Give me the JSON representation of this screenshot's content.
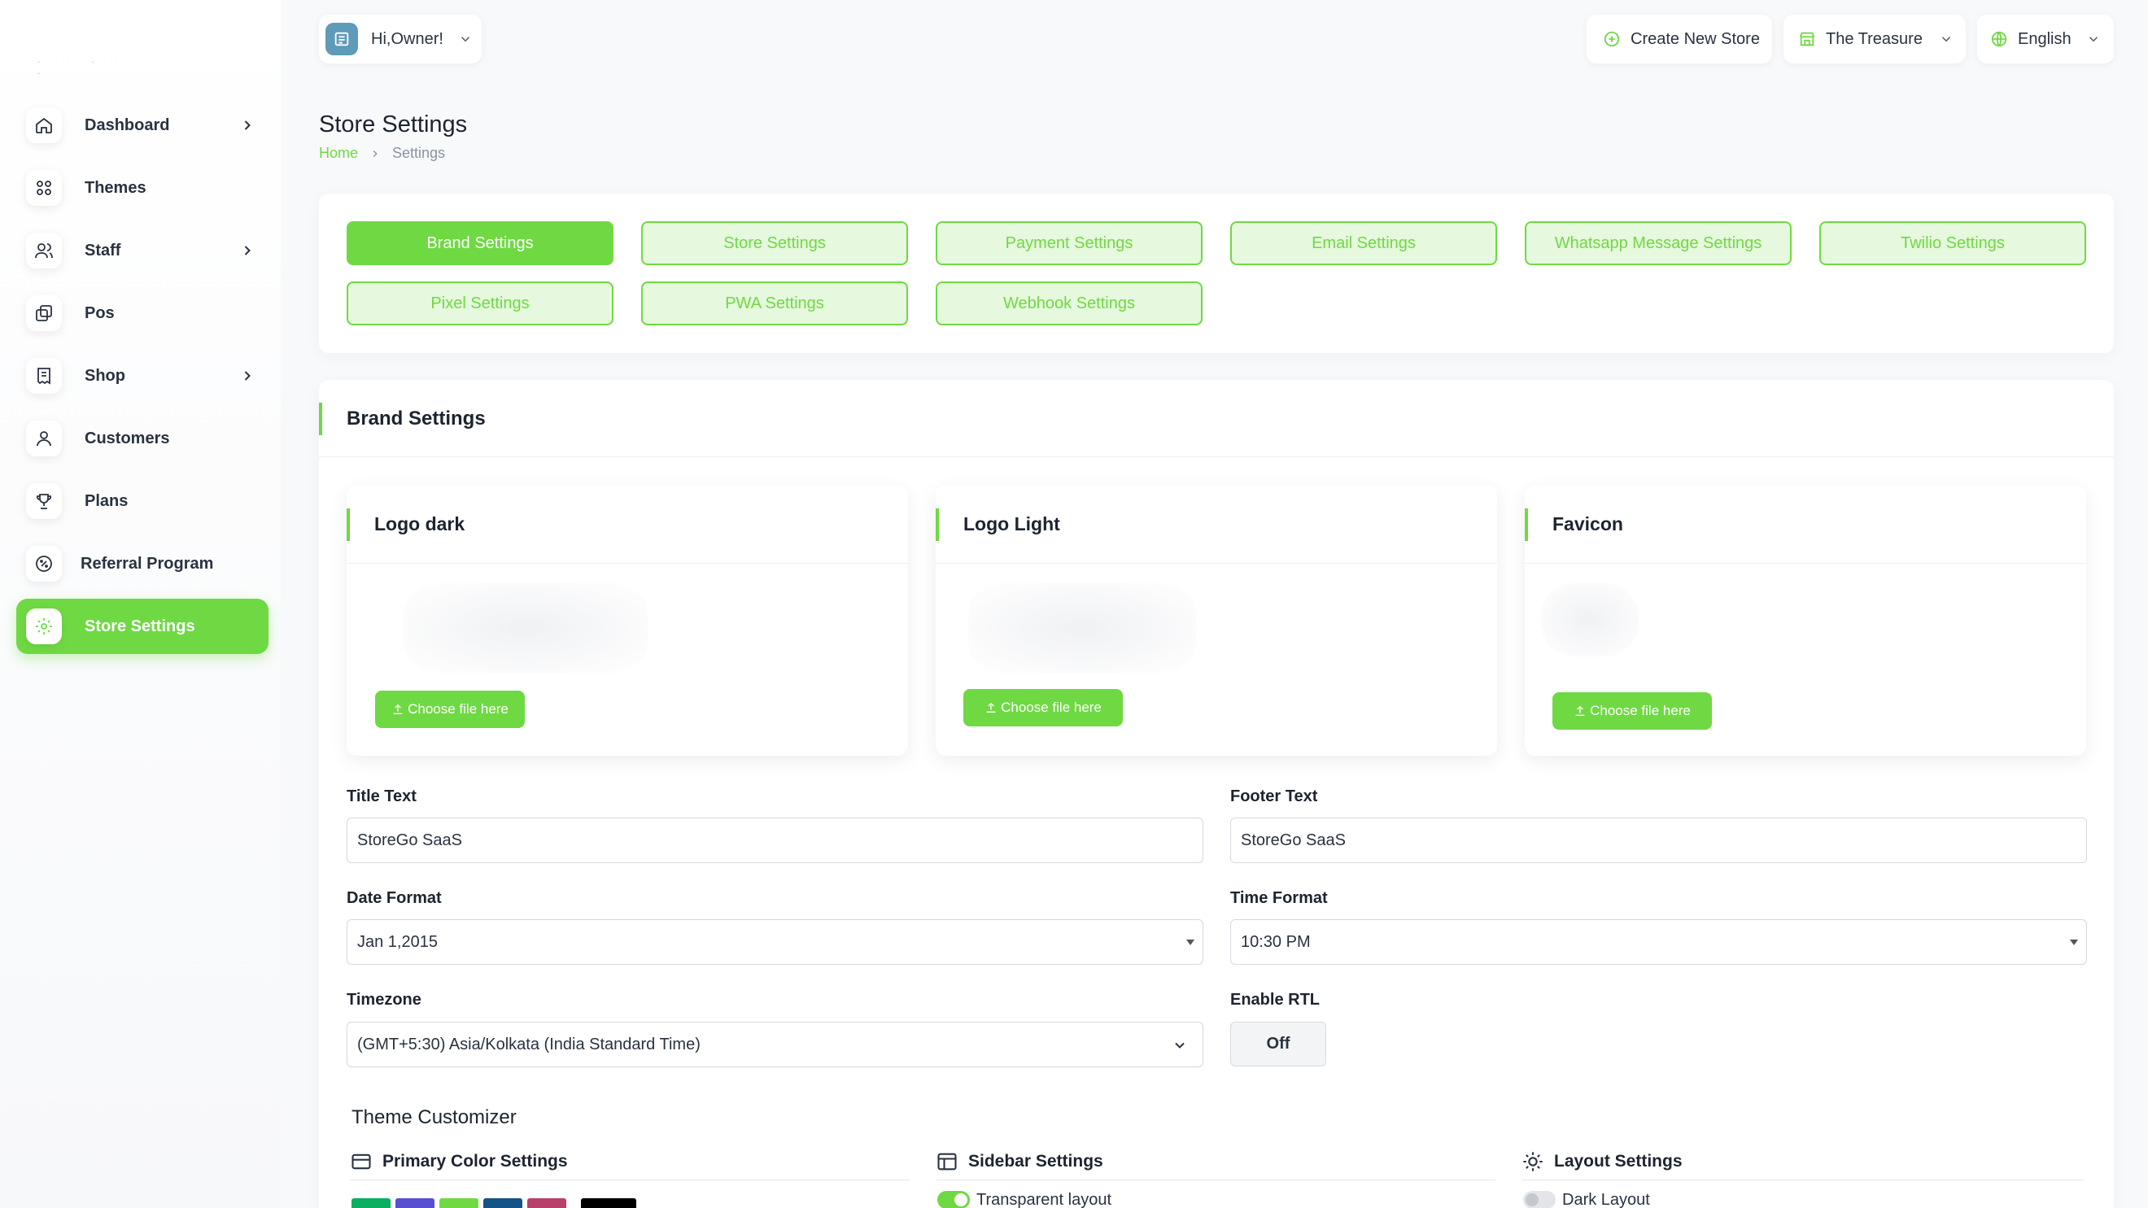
{
  "header": {
    "greeting": "Hi,Owner!",
    "create_store": "Create New Store",
    "store_name": "The Treasure",
    "language": "English"
  },
  "sidebar": {
    "items": [
      {
        "label": "Dashboard",
        "icon": "home-icon",
        "has_children": true
      },
      {
        "label": "Themes",
        "icon": "grid-icon",
        "has_children": false
      },
      {
        "label": "Staff",
        "icon": "users-icon",
        "has_children": true
      },
      {
        "label": "Pos",
        "icon": "layers-icon",
        "has_children": false
      },
      {
        "label": "Shop",
        "icon": "receipt-icon",
        "has_children": true
      },
      {
        "label": "Customers",
        "icon": "user-icon",
        "has_children": false
      },
      {
        "label": "Plans",
        "icon": "trophy-icon",
        "has_children": false
      },
      {
        "label": "Referral Program",
        "icon": "discount-icon",
        "has_children": false
      },
      {
        "label": "Store Settings",
        "icon": "settings-icon",
        "has_children": false,
        "active": true
      }
    ]
  },
  "page": {
    "title": "Store Settings",
    "breadcrumb": [
      "Home",
      "Settings"
    ]
  },
  "settings_tabs": [
    {
      "label": "Brand Settings",
      "active": true
    },
    {
      "label": "Store Settings"
    },
    {
      "label": "Payment Settings"
    },
    {
      "label": "Email Settings"
    },
    {
      "label": "Whatsapp Message Settings"
    },
    {
      "label": "Twilio Settings"
    },
    {
      "label": "Pixel Settings"
    },
    {
      "label": "PWA Settings"
    },
    {
      "label": "Webhook Settings"
    }
  ],
  "brand": {
    "section_title": "Brand Settings",
    "uploads": [
      {
        "title": "Logo dark",
        "button": "Choose file here"
      },
      {
        "title": "Logo Light",
        "button": "Choose file here"
      },
      {
        "title": "Favicon",
        "button": "Choose file here"
      }
    ],
    "fields": {
      "title_text": {
        "label": "Title Text",
        "value": "StoreGo SaaS"
      },
      "footer_text": {
        "label": "Footer Text",
        "value": "StoreGo SaaS"
      },
      "date_format": {
        "label": "Date Format",
        "value": "Jan 1,2015"
      },
      "time_format": {
        "label": "Time Format",
        "value": "10:30 PM"
      },
      "timezone": {
        "label": "Timezone",
        "value": "(GMT+5:30) Asia/Kolkata (India Standard Time)"
      },
      "enable_rtl": {
        "label": "Enable RTL",
        "value": "Off"
      }
    },
    "theme_customizer": {
      "title": "Theme Customizer",
      "primary_color": "Primary Color Settings",
      "sidebar": "Sidebar Settings",
      "layout": "Layout Settings",
      "transparent_layout": "Transparent layout",
      "dark_layout": "Dark Layout",
      "swatches": [
        "#0caf60",
        "#584ed2",
        "#6fd943",
        "#145388",
        "#b9406b",
        "#000000"
      ]
    }
  },
  "colors": {
    "accent": "#6fd943"
  }
}
